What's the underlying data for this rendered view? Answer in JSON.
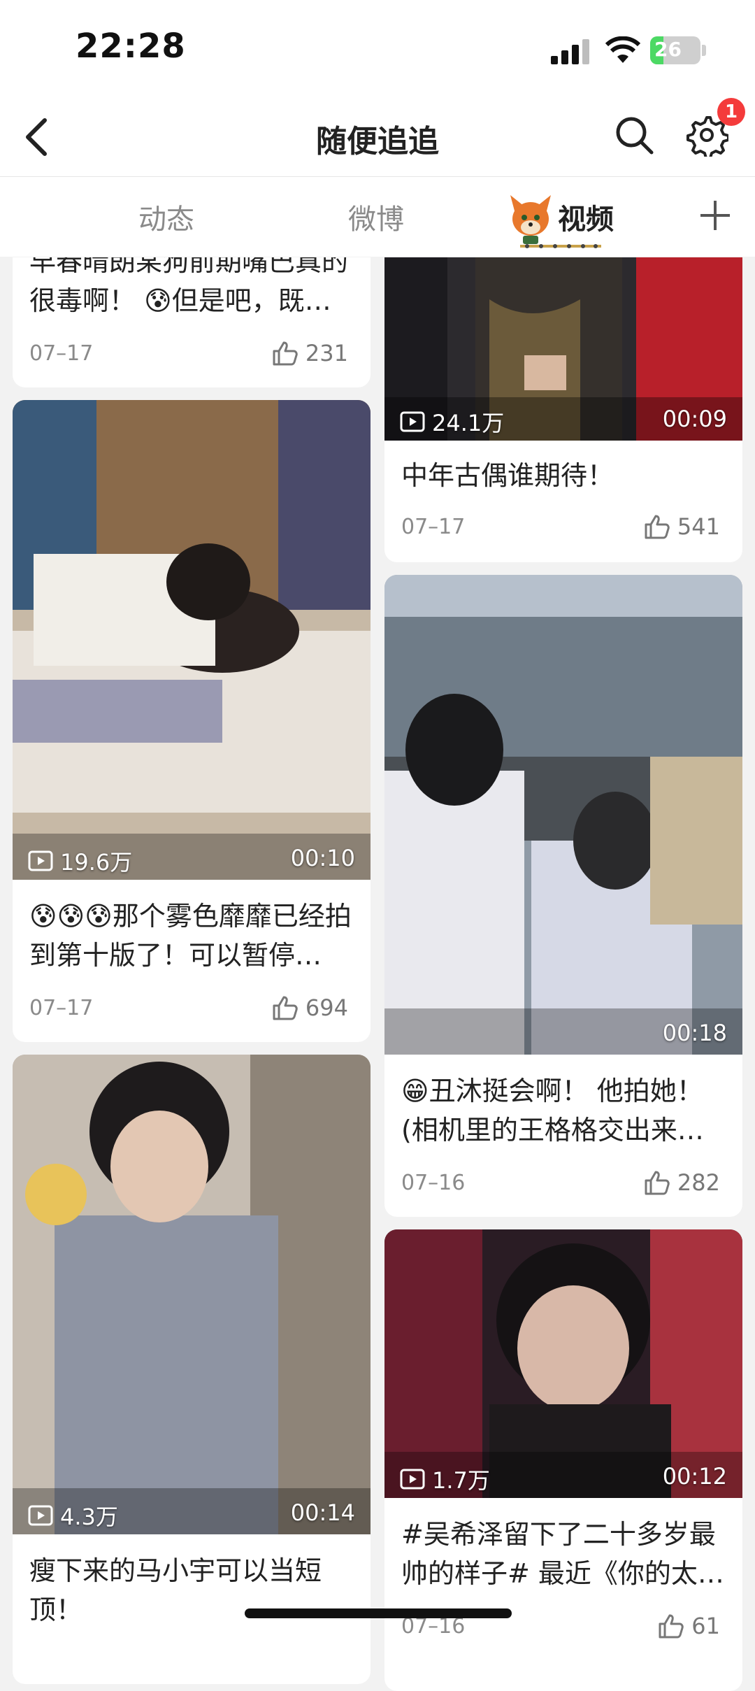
{
  "status_bar": {
    "time": "22:28",
    "battery": "26"
  },
  "header": {
    "title": "随便追追",
    "badge_count": "1"
  },
  "tabs": [
    {
      "label": "动态"
    },
    {
      "label": "微博"
    },
    {
      "label": "视频"
    }
  ],
  "cards": {
    "c1": {
      "caption": "早春晴朗某狗前期嘴巴真的很毒啊！ 😰但是吧，既…",
      "date": "07–17",
      "likes": "231"
    },
    "c2": {
      "plays": "24.1万",
      "duration": "00:09",
      "caption": "中年古偶谁期待！",
      "date": "07–17",
      "likes": "541"
    },
    "c3": {
      "plays": "19.6万",
      "duration": "00:10",
      "caption": "😰😰😰那个雾色靡靡已经拍到第十版了！可以暂停…",
      "date": "07–17",
      "likes": "694"
    },
    "c4": {
      "duration": "00:18",
      "caption": "😁丑沐挺会啊！ 他拍她！(相机里的王格格交出来…",
      "date": "07–16",
      "likes": "282"
    },
    "c5": {
      "plays": "4.3万",
      "duration": "00:14",
      "caption": "瘦下来的马小宇可以当短顶！"
    },
    "c6": {
      "plays": "1.7万",
      "duration": "00:12",
      "caption": "#吴希泽留下了二十多岁最帅的样子# 最近《你的太…",
      "date": "07–16",
      "likes": "61"
    }
  }
}
